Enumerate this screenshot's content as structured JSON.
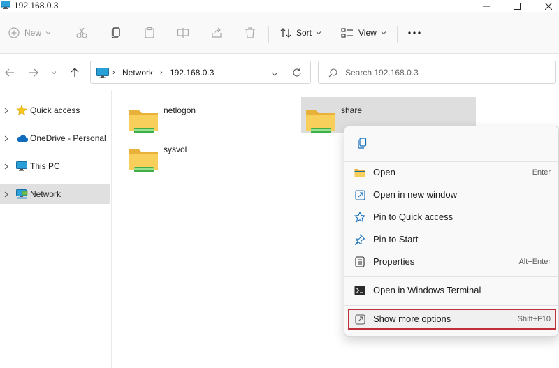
{
  "window": {
    "title": "192.168.0.3"
  },
  "toolbar": {
    "new_label": "New",
    "sort_label": "Sort",
    "view_label": "View",
    "more_label": "..."
  },
  "address": {
    "crumbs": [
      "Network",
      "192.168.0.3"
    ],
    "search_placeholder": "Search 192.168.0.3"
  },
  "sidebar": {
    "items": [
      {
        "label": "Quick access",
        "icon": "star-icon"
      },
      {
        "label": "OneDrive - Personal",
        "icon": "cloud-icon"
      },
      {
        "label": "This PC",
        "icon": "monitor-icon"
      },
      {
        "label": "Network",
        "icon": "network-icon",
        "selected": true
      }
    ]
  },
  "content": {
    "items": [
      {
        "name": "netlogon",
        "icon": "shared-folder-icon"
      },
      {
        "name": "share",
        "icon": "shared-folder-icon",
        "selected": true
      },
      {
        "name": "sysvol",
        "icon": "shared-folder-icon"
      }
    ]
  },
  "context_menu": {
    "top_actions": [
      {
        "icon": "copy-icon"
      }
    ],
    "items": [
      {
        "label": "Open",
        "shortcut": "Enter",
        "icon": "folder-open-icon"
      },
      {
        "label": "Open in new window",
        "shortcut": "",
        "icon": "new-window-icon"
      },
      {
        "label": "Pin to Quick access",
        "shortcut": "",
        "icon": "star-outline-icon"
      },
      {
        "label": "Pin to Start",
        "shortcut": "",
        "icon": "pin-icon"
      },
      {
        "label": "Properties",
        "shortcut": "Alt+Enter",
        "icon": "properties-icon"
      },
      {
        "label": "Open in Windows Terminal",
        "shortcut": "",
        "icon": "terminal-icon"
      },
      {
        "label": "Show more options",
        "shortcut": "Shift+F10",
        "icon": "more-options-icon",
        "highlighted": true
      }
    ]
  },
  "colors": {
    "accent": "#0067c0",
    "folder_yellow": "#f6c94a",
    "share_green": "#3fae49",
    "highlight_border": "#c0303a",
    "selection_gray": "#dedede"
  }
}
